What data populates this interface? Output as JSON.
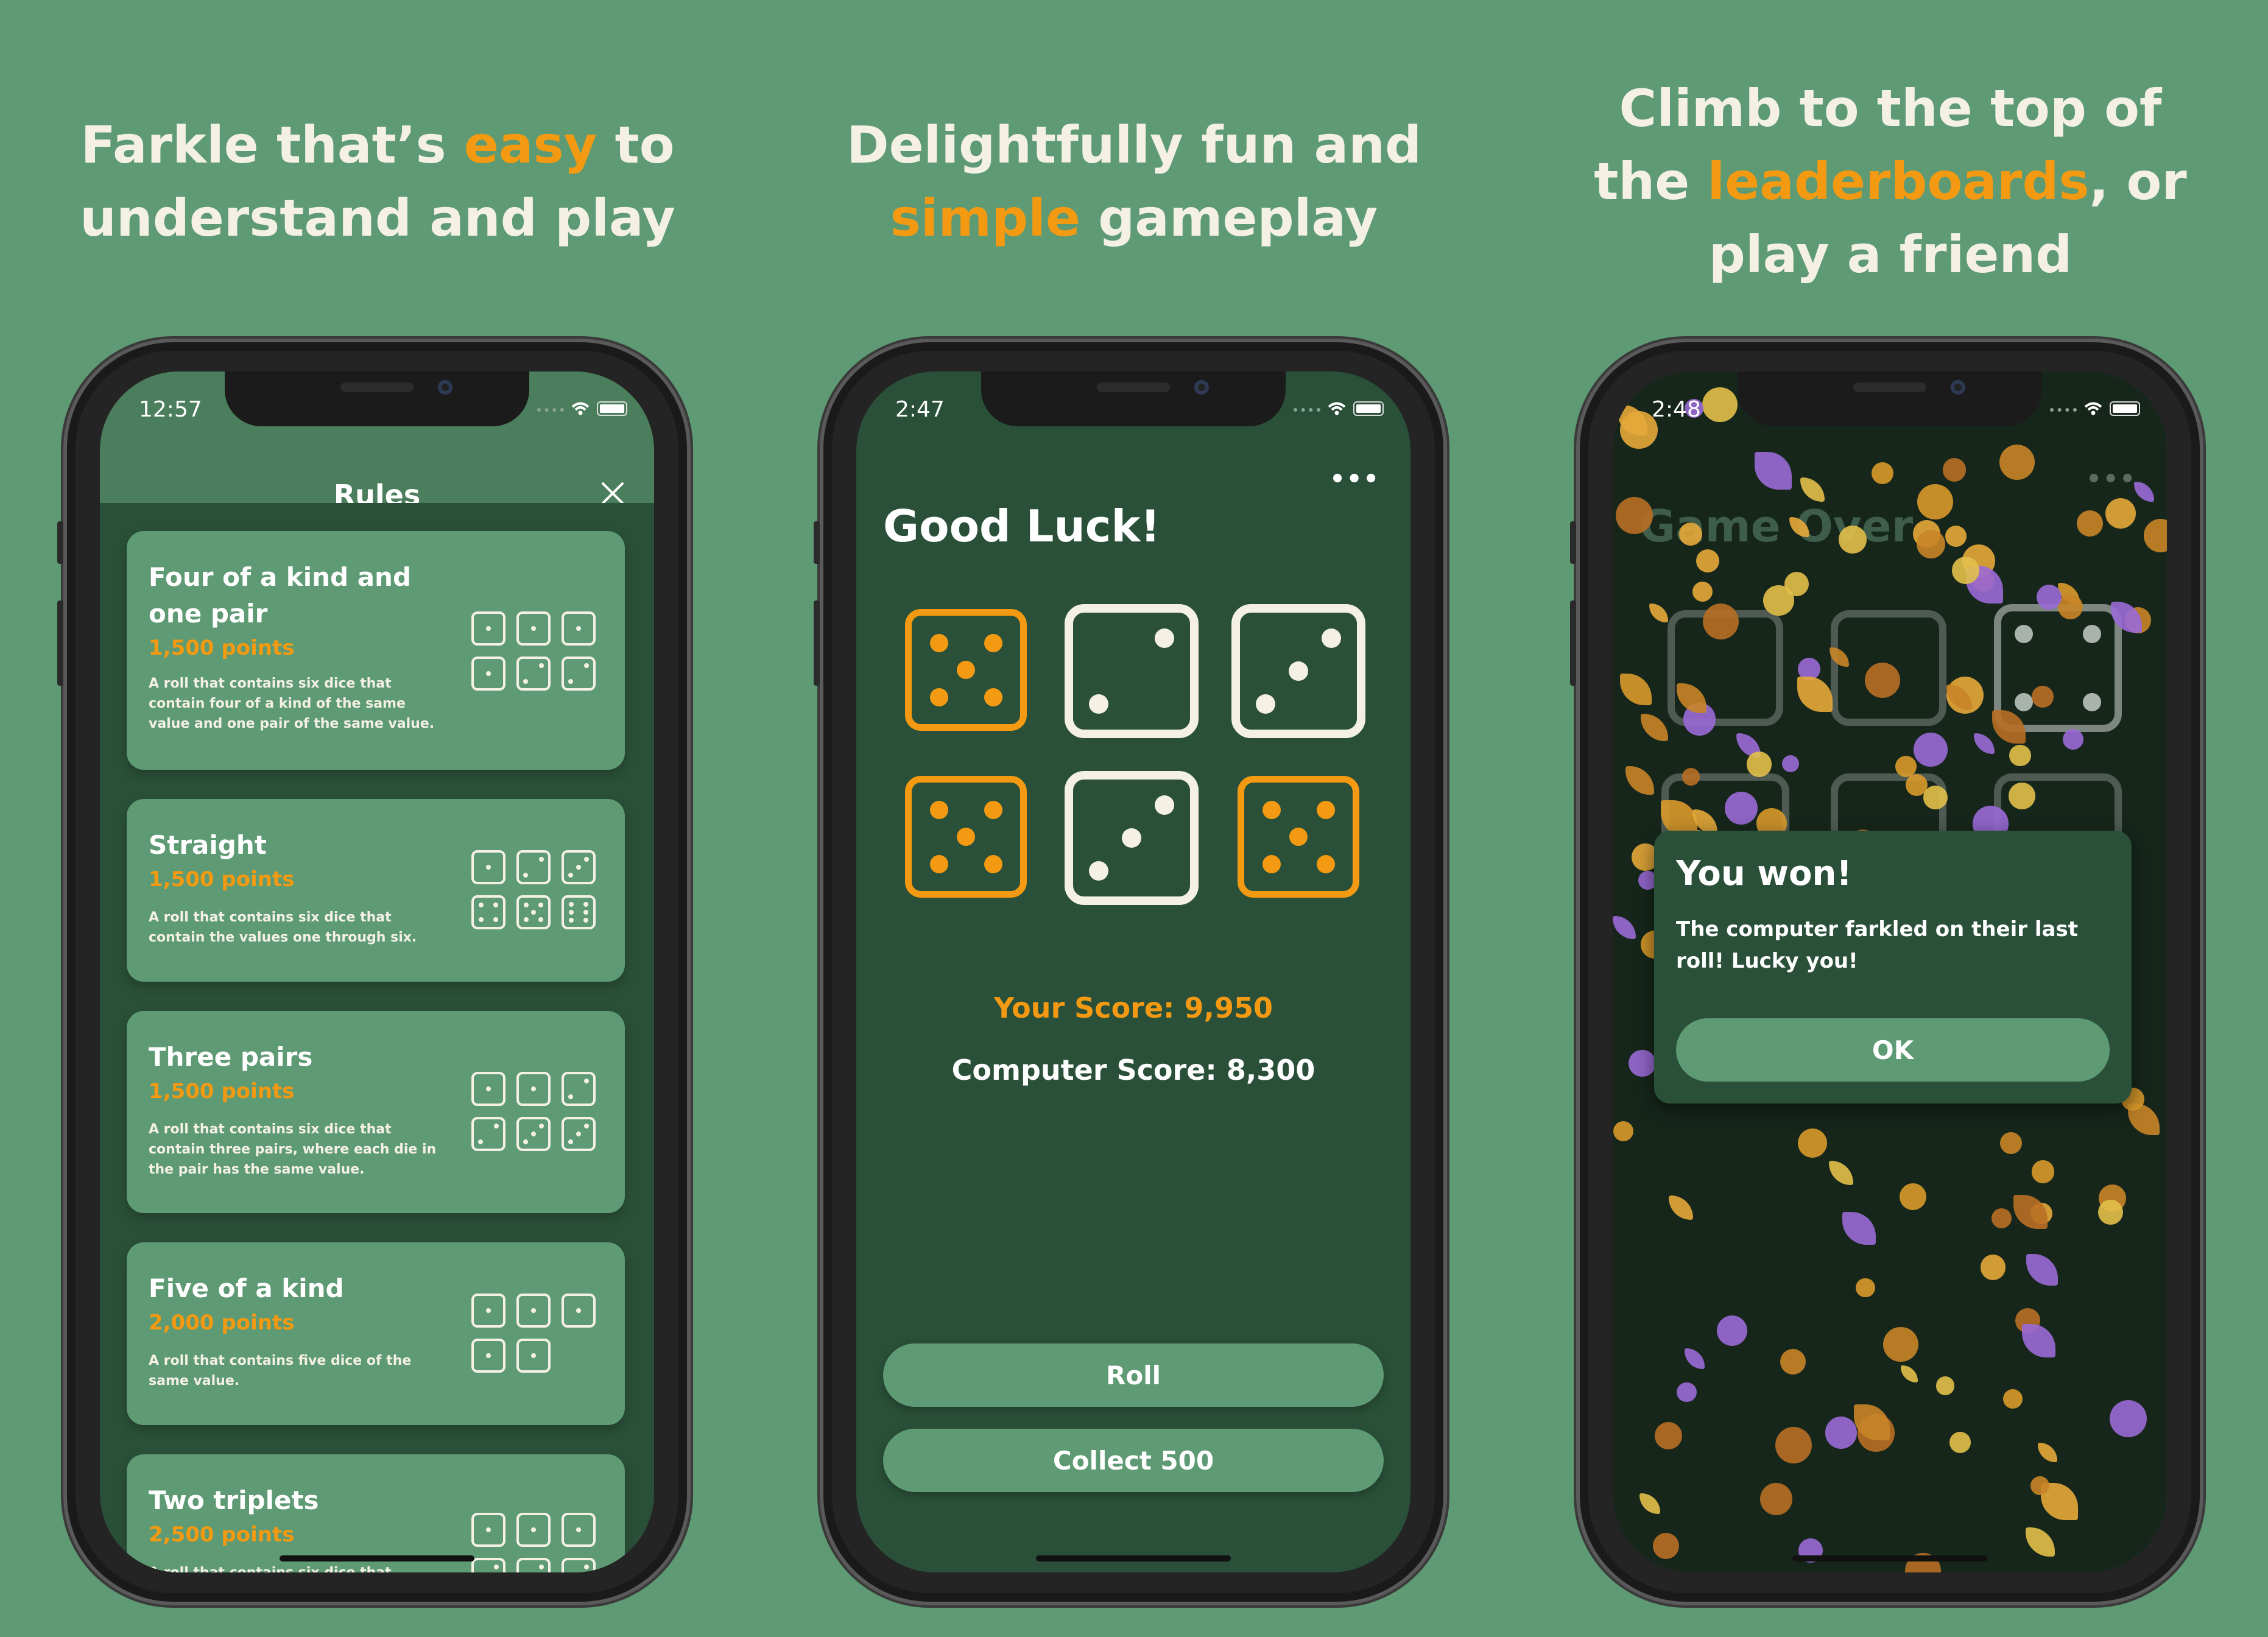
{
  "colors": {
    "background": "#5e9a73",
    "accent": "#f39a12",
    "card": "#5e9a73",
    "screen_bg": "#2a5039",
    "text": "#f4f1e4"
  },
  "panels": [
    {
      "headline": {
        "line1_a": "Farkle that’s ",
        "line1_hl": "easy",
        "line1_b": " to",
        "line2": "understand and play"
      },
      "screen": {
        "time": "12:57",
        "title": "Rules",
        "close_icon": "close-icon",
        "rules": [
          {
            "name": "Four of a kind and one pair",
            "points": "1,500 points",
            "desc": "A roll that contains six dice that contain four of a kind of the same value and one pair of the same value."
          },
          {
            "name": "Straight",
            "points": "1,500 points",
            "desc": "A roll that contains six dice that contain the values one through six."
          },
          {
            "name": "Three pairs",
            "points": "1,500 points",
            "desc": "A roll that contains six dice that contain three pairs, where each die in the pair has the same value."
          },
          {
            "name": "Five of a kind",
            "points": "2,000 points",
            "desc": "A roll that contains five dice of the same value."
          },
          {
            "name": "Two triplets",
            "points": "2,500 points",
            "desc": "A roll that contains six dice that contain"
          }
        ]
      }
    },
    {
      "headline": {
        "line1": "Delightfully fun and",
        "line2_hl": "simple",
        "line2_b": " gameplay"
      },
      "screen": {
        "time": "2:47",
        "more_icon": "more-icon",
        "title": "Good Luck!",
        "dice": [
          {
            "value": 5,
            "held": true
          },
          {
            "value": 2,
            "held": false
          },
          {
            "value": 3,
            "held": false
          },
          {
            "value": 5,
            "held": true
          },
          {
            "value": 3,
            "held": false
          },
          {
            "value": 5,
            "held": true
          }
        ],
        "your_score": "Your Score: 9,950",
        "computer_score": "Computer Score: 8,300",
        "roll_label": "Roll",
        "collect_label": "Collect 500"
      }
    },
    {
      "headline": {
        "line1": "Climb to the top of",
        "line2_a": "the ",
        "line2_hl": "leaderboards",
        "line2_b": ", or",
        "line3": "play a friend"
      },
      "screen": {
        "time": "2:48",
        "more_icon": "more-icon",
        "title": "Game Over",
        "alert": {
          "title": "You won!",
          "message": "The computer farkled on their last roll! Lucky you!",
          "ok_label": "OK"
        }
      }
    }
  ]
}
